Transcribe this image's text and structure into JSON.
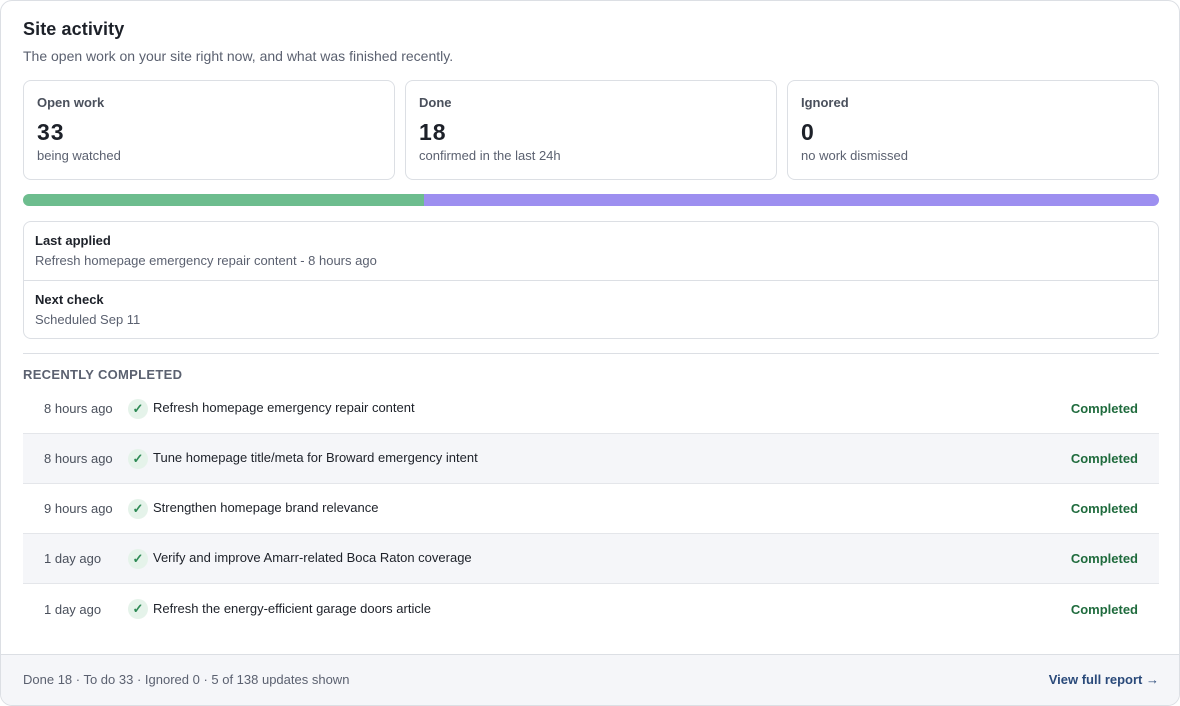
{
  "header": {
    "title": "Site activity",
    "subtitle": "The open work on your site right now, and what was finished recently."
  },
  "stats": [
    {
      "label": "Open work",
      "value": "33",
      "note": "being watched"
    },
    {
      "label": "Done",
      "value": "18",
      "note": "confirmed in the last 24h"
    },
    {
      "label": "Ignored",
      "value": "0",
      "note": "no work dismissed"
    }
  ],
  "progress": {
    "done_fraction": 0.353,
    "open_fraction": 0.647,
    "done_color": "#6dbd8e",
    "open_color": "#9d8ff0"
  },
  "info": {
    "last_applied_label": "Last applied",
    "last_applied_value": "Refresh homepage emergency repair content - 8 hours ago",
    "next_check_label": "Next check",
    "next_check_value": "Scheduled Sep 11"
  },
  "recent": {
    "title": "RECENTLY COMPLETED",
    "items": [
      {
        "time": "8 hours ago",
        "text": "Refresh homepage emergency repair content",
        "status": "Completed",
        "icon": "check-icon"
      },
      {
        "time": "8 hours ago",
        "text": "Tune homepage title/meta for Broward emergency intent",
        "status": "Completed",
        "icon": "check-icon"
      },
      {
        "time": "9 hours ago",
        "text": "Strengthen homepage brand relevance",
        "status": "Completed",
        "icon": "check-icon"
      },
      {
        "time": "1 day ago",
        "text": "Verify and improve Amarr-related Boca Raton coverage",
        "status": "Completed",
        "icon": "check-icon"
      },
      {
        "time": "1 day ago",
        "text": "Refresh the energy-efficient garage doors article",
        "status": "Completed",
        "icon": "check-icon"
      }
    ]
  },
  "footer": {
    "summary": "Done 18 · To do 33 · Ignored 0 · 5 of 138 updates shown",
    "link": "View full report →"
  }
}
